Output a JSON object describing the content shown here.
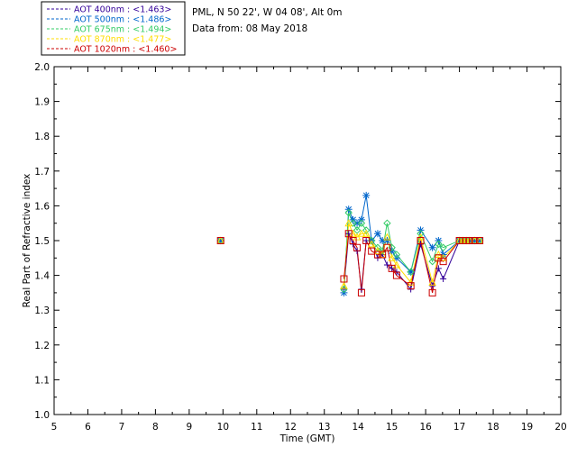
{
  "header": {
    "site": "PML, N 50 22', W 04 08', Alt 0m",
    "date": "Data from: 08 May 2018"
  },
  "legend": [
    {
      "label": "AOT  400nm : <1.463>",
      "color": "#330099"
    },
    {
      "label": "AOT  500nm : <1.486>",
      "color": "#0066cc"
    },
    {
      "label": "AOT  675nm : <1.494>",
      "color": "#33cc66"
    },
    {
      "label": "AOT  870nm : <1.477>",
      "color": "#ffdd00"
    },
    {
      "label": "AOT 1020nm : <1.460>",
      "color": "#cc0000"
    }
  ],
  "chart_data": {
    "type": "line",
    "xlabel": "Time (GMT)",
    "ylabel": "Real Part of Refractive index",
    "xlim": [
      5,
      20
    ],
    "ylim": [
      1.0,
      2.0
    ],
    "xticks": [
      "5",
      "6",
      "7",
      "8",
      "9",
      "10",
      "11",
      "12",
      "13",
      "14",
      "15",
      "16",
      "17",
      "18",
      "19",
      "20"
    ],
    "yticks": [
      "1.0",
      "1.1",
      "1.2",
      "1.3",
      "1.4",
      "1.5",
      "1.6",
      "1.7",
      "1.8",
      "1.9",
      "2.0"
    ],
    "grid": false,
    "series": [
      {
        "name": "AOT  400nm",
        "color": "#330099",
        "marker": "plus",
        "x": [
          9.93,
          13.58,
          13.72,
          13.85,
          13.97,
          14.1,
          14.24,
          14.4,
          14.58,
          14.72,
          14.86,
          15.0,
          15.14,
          15.56,
          15.85,
          16.2,
          16.38,
          16.52,
          17.0,
          17.1,
          17.2,
          17.3,
          17.45,
          17.6
        ],
        "y": [
          1.5,
          1.36,
          1.52,
          1.49,
          1.47,
          1.36,
          1.5,
          1.5,
          1.45,
          1.46,
          1.43,
          1.42,
          1.41,
          1.36,
          1.49,
          1.37,
          1.42,
          1.39,
          1.5,
          1.5,
          1.5,
          1.5,
          1.5,
          1.5
        ]
      },
      {
        "name": "AOT  500nm",
        "color": "#0066cc",
        "marker": "asterisk",
        "x": [
          9.93,
          13.58,
          13.72,
          13.85,
          13.97,
          14.1,
          14.24,
          14.4,
          14.58,
          14.72,
          14.86,
          15.0,
          15.14,
          15.56,
          15.85,
          16.2,
          16.38,
          16.52,
          17.0,
          17.1,
          17.2,
          17.3,
          17.45,
          17.6
        ],
        "y": [
          1.5,
          1.35,
          1.59,
          1.56,
          1.55,
          1.56,
          1.63,
          1.5,
          1.52,
          1.5,
          1.5,
          1.47,
          1.45,
          1.41,
          1.53,
          1.48,
          1.5,
          1.46,
          1.5,
          1.5,
          1.5,
          1.5,
          1.5,
          1.5
        ]
      },
      {
        "name": "AOT  675nm",
        "color": "#33cc66",
        "marker": "diamond",
        "x": [
          9.93,
          13.58,
          13.72,
          13.85,
          13.97,
          14.1,
          14.24,
          14.4,
          14.58,
          14.72,
          14.86,
          15.0,
          15.14,
          15.56,
          15.85,
          16.2,
          16.38,
          16.52,
          17.0,
          17.1,
          17.2,
          17.3,
          17.45,
          17.6
        ],
        "y": [
          1.5,
          1.36,
          1.58,
          1.55,
          1.53,
          1.55,
          1.53,
          1.5,
          1.48,
          1.47,
          1.55,
          1.48,
          1.46,
          1.41,
          1.52,
          1.44,
          1.49,
          1.48,
          1.5,
          1.5,
          1.5,
          1.5,
          1.5,
          1.5
        ]
      },
      {
        "name": "AOT  870nm",
        "color": "#ffdd00",
        "marker": "triangle",
        "x": [
          9.93,
          13.58,
          13.72,
          13.85,
          13.97,
          14.1,
          14.24,
          14.4,
          14.58,
          14.72,
          14.86,
          15.0,
          15.14,
          15.56,
          15.85,
          16.2,
          16.38,
          16.52,
          17.0,
          17.1,
          17.2,
          17.3,
          17.45,
          17.6
        ],
        "y": [
          1.5,
          1.37,
          1.55,
          1.52,
          1.51,
          1.52,
          1.52,
          1.49,
          1.47,
          1.46,
          1.51,
          1.45,
          1.43,
          1.38,
          1.51,
          1.38,
          1.46,
          1.45,
          1.5,
          1.5,
          1.5,
          1.5,
          1.5,
          1.5
        ]
      },
      {
        "name": "AOT 1020nm",
        "color": "#cc0000",
        "marker": "square",
        "x": [
          9.93,
          13.58,
          13.72,
          13.85,
          13.97,
          14.1,
          14.24,
          14.4,
          14.58,
          14.72,
          14.86,
          15.0,
          15.14,
          15.56,
          15.85,
          16.2,
          16.38,
          16.52,
          17.0,
          17.1,
          17.2,
          17.3,
          17.45,
          17.6
        ],
        "y": [
          1.5,
          1.39,
          1.52,
          1.5,
          1.48,
          1.35,
          1.5,
          1.47,
          1.46,
          1.46,
          1.48,
          1.42,
          1.4,
          1.37,
          1.5,
          1.35,
          1.45,
          1.44,
          1.5,
          1.5,
          1.5,
          1.5,
          1.5,
          1.5
        ]
      }
    ]
  }
}
